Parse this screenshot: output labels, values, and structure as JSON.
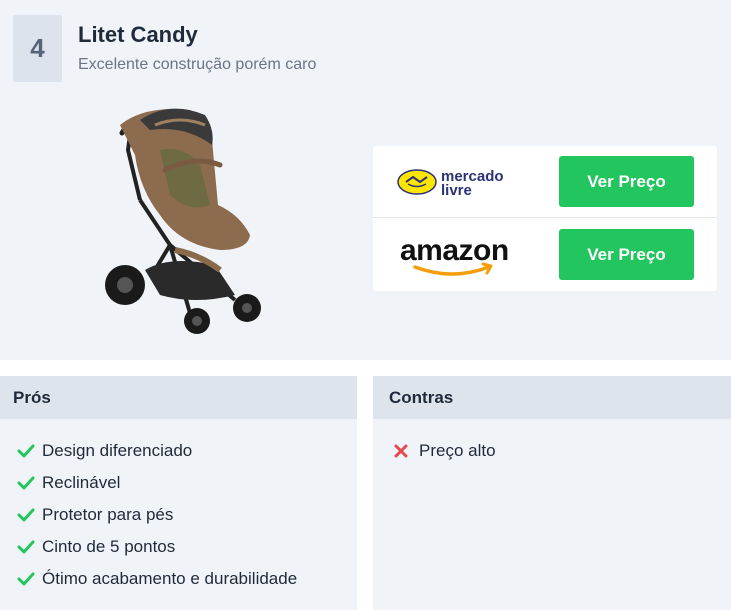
{
  "product": {
    "rank": "4",
    "title": "Litet Candy",
    "subtitle": "Excelente construção porém caro",
    "image": "stroller-image"
  },
  "stores": [
    {
      "logo_icon": "mercado-livre-logo",
      "logo_text": "mercado livre",
      "button_label": "Ver Preço"
    },
    {
      "logo_icon": "amazon-logo",
      "logo_text": "amazon",
      "button_label": "Ver Preço"
    }
  ],
  "pros": {
    "heading": "Prós",
    "items": [
      "Design diferenciado",
      "Reclinável",
      "Protetor para pés",
      "Cinto de 5 pontos",
      "Ótimo acabamento e durabilidade"
    ]
  },
  "cons": {
    "heading": "Contras",
    "items": [
      "Preço alto"
    ]
  },
  "colors": {
    "accent_green": "#22c55e",
    "cross_red": "#e5484d",
    "background": "#f0f3f8"
  }
}
